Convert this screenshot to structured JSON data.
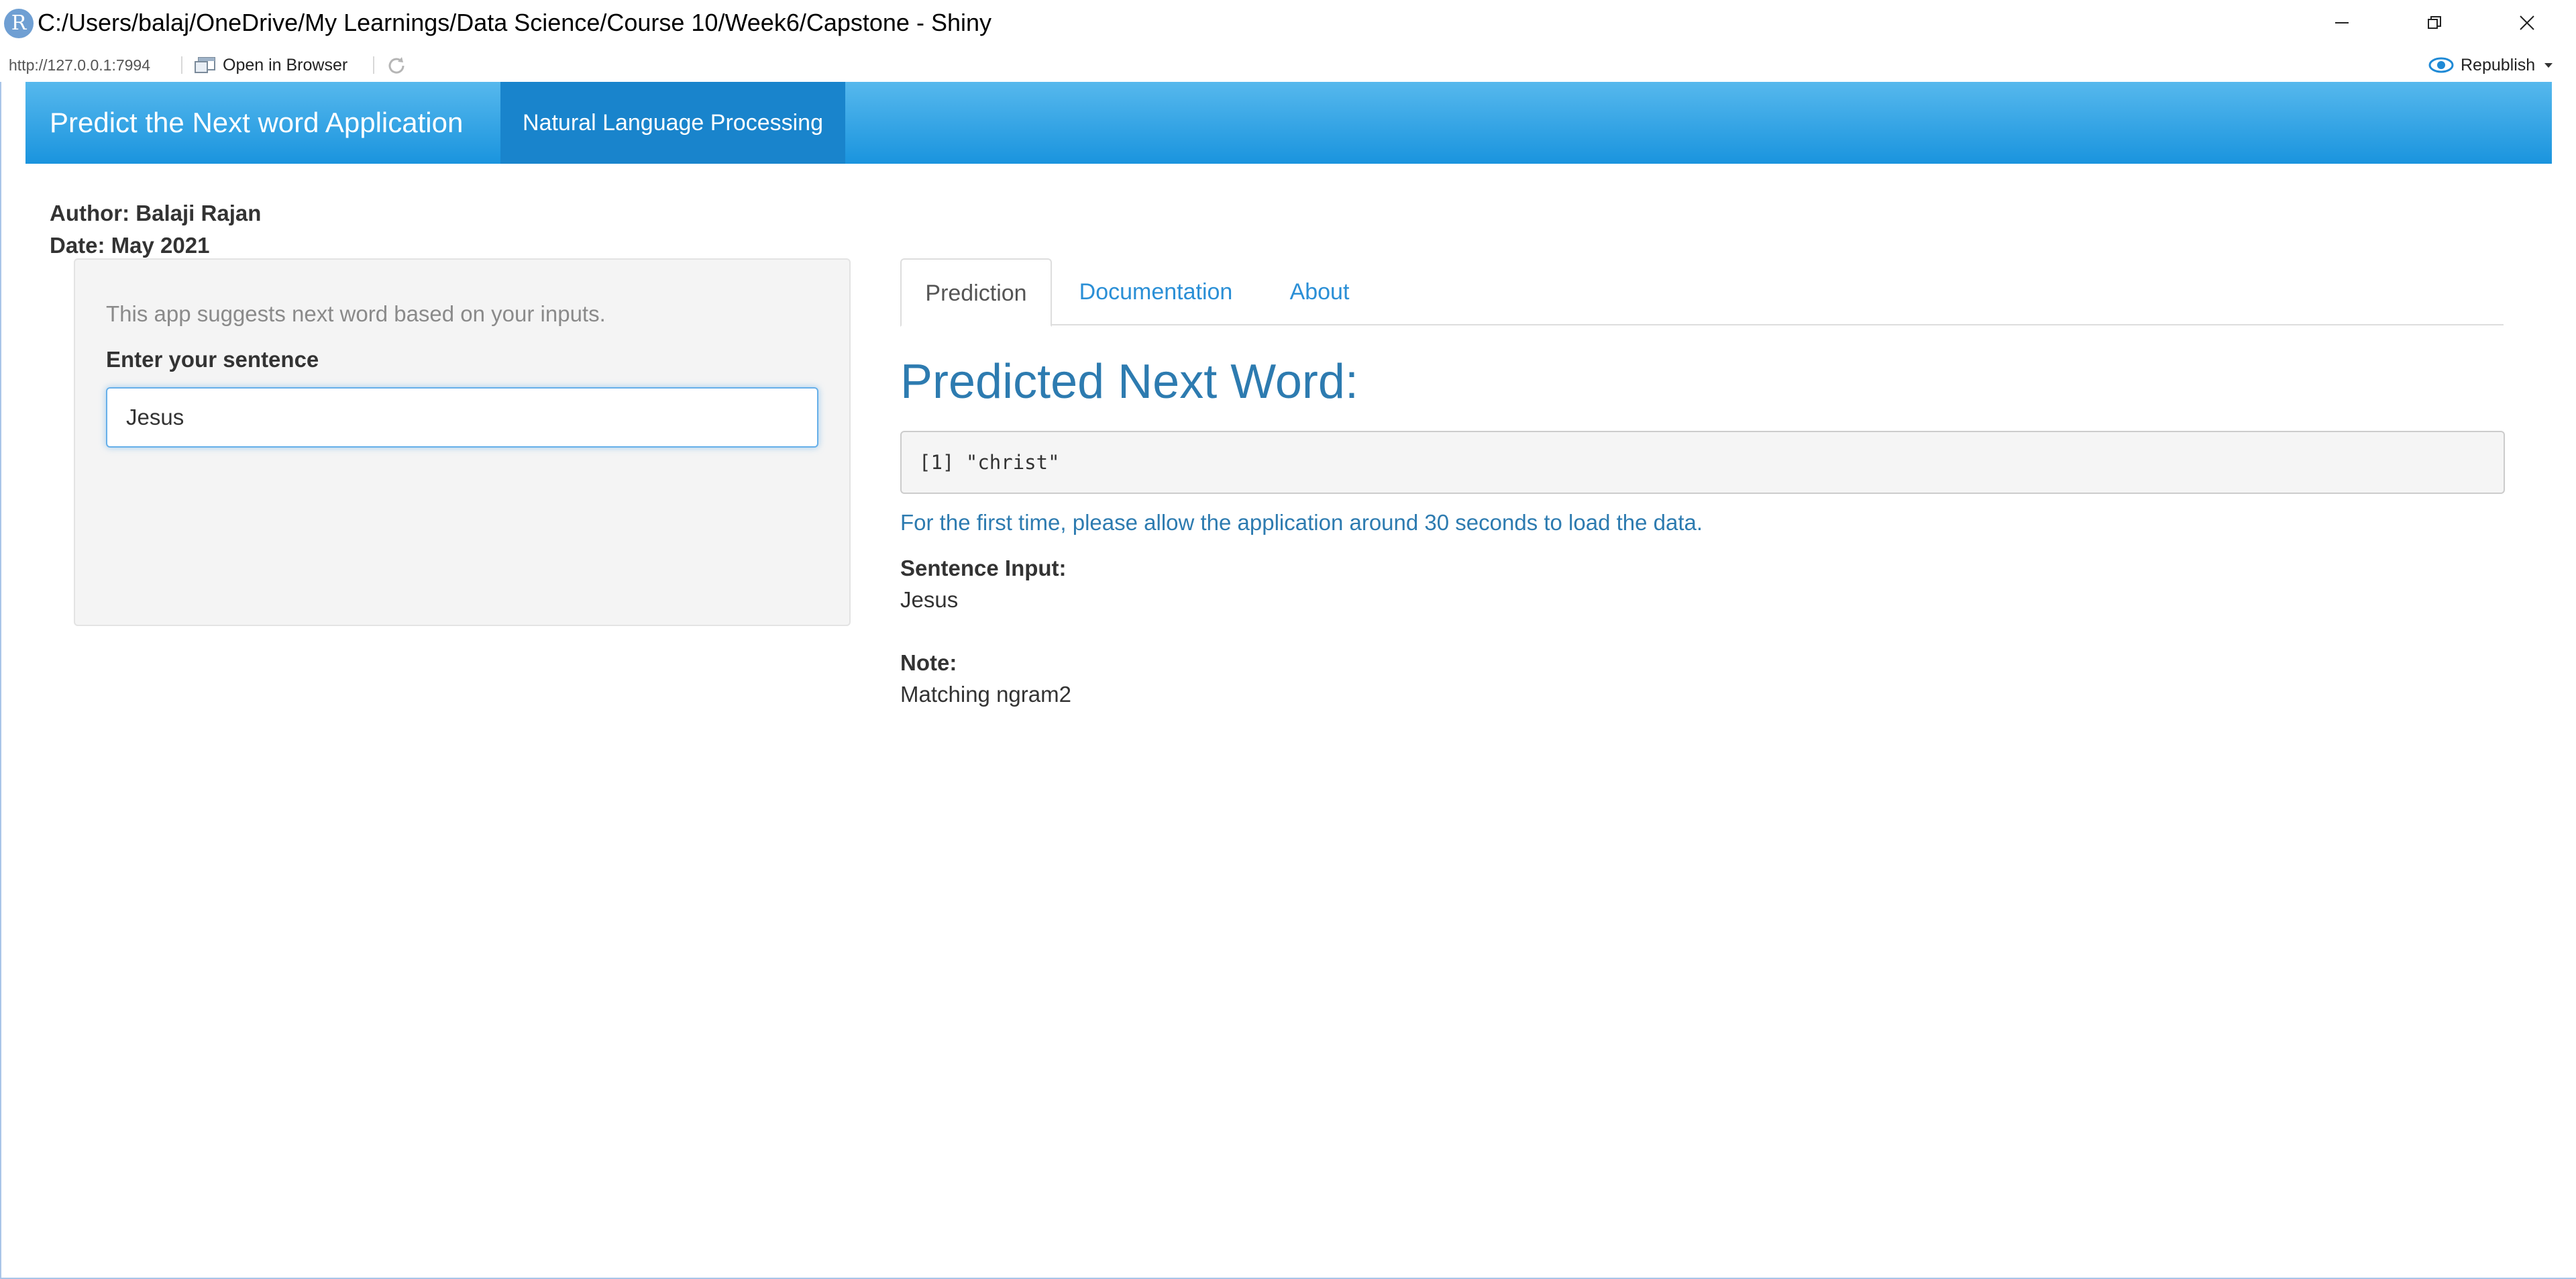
{
  "window": {
    "title": "C:/Users/balaj/OneDrive/My Learnings/Data Science/Course 10/Week6/Capstone - Shiny",
    "logo_letter": "R"
  },
  "toolbar": {
    "url": "http://127.0.0.1:7994",
    "open_in_browser": "Open in Browser",
    "republish": "Republish"
  },
  "navbar": {
    "brand": "Predict the Next word Application",
    "items": [
      {
        "label": "Natural Language Processing",
        "active": true
      }
    ],
    "colors": {
      "gradient_top": "#56b8ed",
      "gradient_bottom": "#1a94de",
      "active_item": "#1984cc"
    }
  },
  "header": {
    "author": "Author: Balaji Rajan",
    "date": "Date: May 2021"
  },
  "sidebar": {
    "help_text": "This app suggests next word based on your inputs.",
    "input_label": "Enter your sentence",
    "input_value": "Jesus"
  },
  "main": {
    "tabs": [
      {
        "label": "Prediction",
        "active": true
      },
      {
        "label": "Documentation",
        "active": false
      },
      {
        "label": "About",
        "active": false
      }
    ],
    "heading": "Predicted Next Word:",
    "output_index": "[1]",
    "output_value": "\"christ\"",
    "load_note": "For the first time, please allow the application around 30 seconds to load the data.",
    "sentence_label": "Sentence Input:",
    "sentence_value": "Jesus",
    "note_label": "Note:",
    "note_value": "Matching ngram2"
  },
  "icons": {
    "r_logo": "r-logo-icon",
    "open_in_browser": "browser-window-icon",
    "refresh": "refresh-icon",
    "republish": "publish-icon",
    "republish_menu": "caret-down-icon",
    "minimize": "minimize-icon",
    "restore": "restore-icon",
    "close": "close-icon"
  }
}
